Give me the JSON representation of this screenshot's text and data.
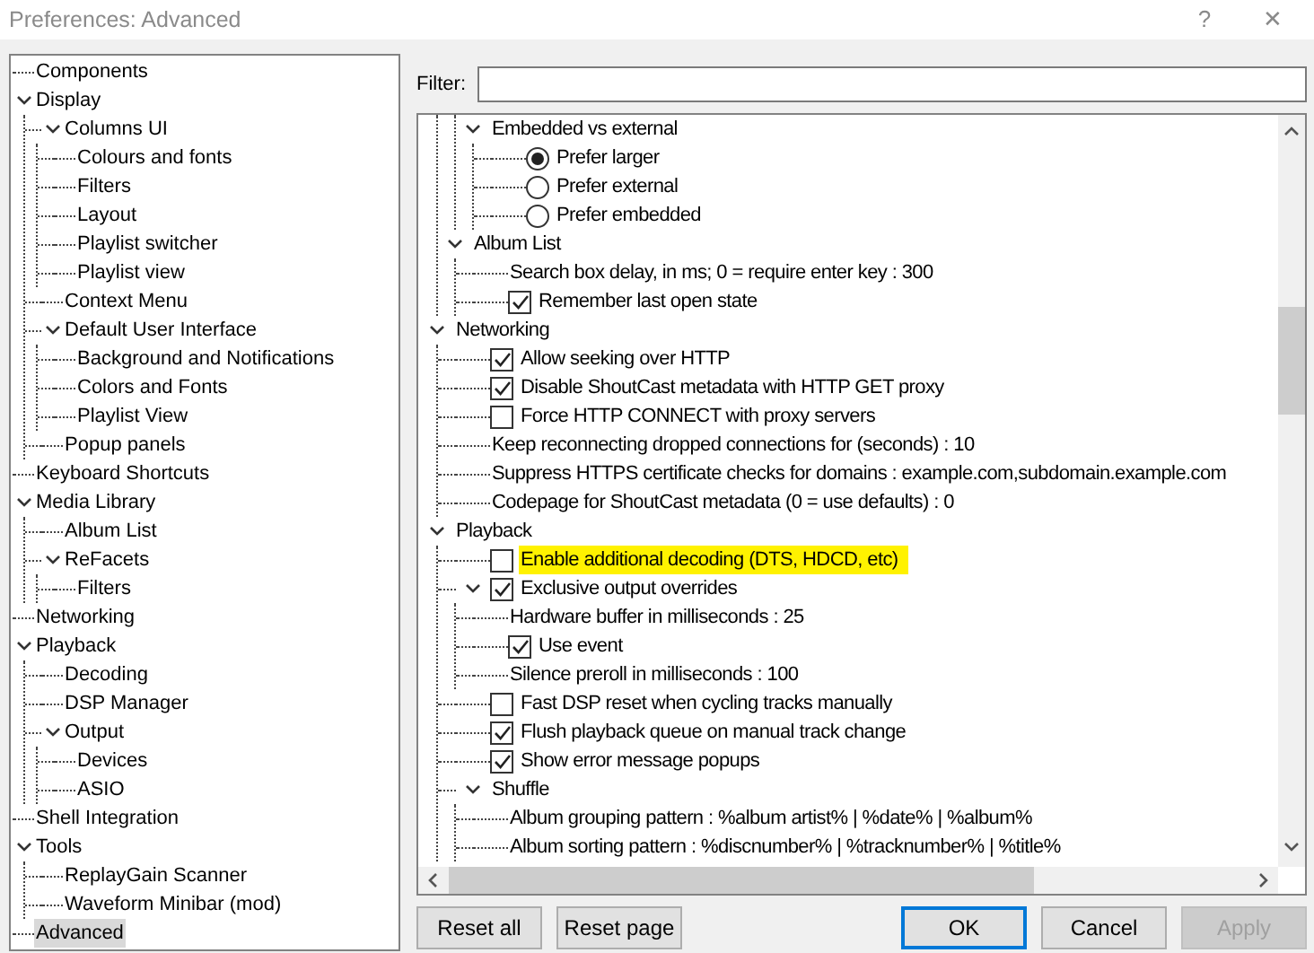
{
  "window": {
    "title": "Preferences: Advanced",
    "buttons": [
      "?",
      "✕"
    ]
  },
  "sidebar": {
    "items": [
      {
        "label": "Components",
        "selected": false
      },
      {
        "label": "Display",
        "selected": false,
        "expanded": true,
        "children": [
          {
            "label": "Columns UI",
            "selected": false,
            "expanded": true,
            "children": [
              {
                "label": "Colours and fonts",
                "selected": false
              },
              {
                "label": "Filters",
                "selected": false
              },
              {
                "label": "Layout",
                "selected": false
              },
              {
                "label": "Playlist switcher",
                "selected": false
              },
              {
                "label": "Playlist view",
                "selected": false
              }
            ]
          },
          {
            "label": "Context Menu",
            "selected": false
          },
          {
            "label": "Default User Interface",
            "selected": false,
            "expanded": true,
            "children": [
              {
                "label": "Background and Notifications",
                "selected": false
              },
              {
                "label": "Colors and Fonts",
                "selected": false
              },
              {
                "label": "Playlist View",
                "selected": false
              }
            ]
          },
          {
            "label": "Popup panels",
            "selected": false
          }
        ]
      },
      {
        "label": "Keyboard Shortcuts",
        "selected": false
      },
      {
        "label": "Media Library",
        "selected": false,
        "expanded": true,
        "children": [
          {
            "label": "Album List",
            "selected": false
          },
          {
            "label": "ReFacets",
            "selected": false,
            "expanded": true,
            "children": [
              {
                "label": "Filters",
                "selected": false
              }
            ]
          }
        ]
      },
      {
        "label": "Networking",
        "selected": false
      },
      {
        "label": "Playback",
        "selected": false,
        "expanded": true,
        "children": [
          {
            "label": "Decoding",
            "selected": false
          },
          {
            "label": "DSP Manager",
            "selected": false
          },
          {
            "label": "Output",
            "selected": false,
            "expanded": true,
            "children": [
              {
                "label": "Devices",
                "selected": false
              },
              {
                "label": "ASIO",
                "selected": false
              }
            ]
          }
        ]
      },
      {
        "label": "Shell Integration",
        "selected": false
      },
      {
        "label": "Tools",
        "selected": false,
        "expanded": true,
        "children": [
          {
            "label": "ReplayGain Scanner",
            "selected": false
          },
          {
            "label": "Waveform Minibar (mod)",
            "selected": false
          }
        ]
      },
      {
        "label": "Advanced",
        "selected": true
      }
    ]
  },
  "filter": {
    "label": "Filter:"
  },
  "settings": [
    {
      "children": [
        {
          "children": [
            {
              "label": "Embedded vs external",
              "expanded": true,
              "children": [
                {
                  "kind": "radio",
                  "label": "Prefer larger",
                  "selected": true
                },
                {
                  "kind": "radio",
                  "label": "Prefer external",
                  "selected": false
                },
                {
                  "kind": "radio",
                  "label": "Prefer embedded",
                  "selected": false
                }
              ]
            }
          ]
        },
        {
          "label": "Album List",
          "expanded": true,
          "children": [
            {
              "kind": "text",
              "label": "Search box delay, in ms; 0 = require enter key : 300"
            },
            {
              "kind": "checkbox",
              "label": "Remember last open state",
              "checked": true
            }
          ]
        }
      ]
    },
    {
      "label": "Networking",
      "expanded": true,
      "children": [
        {
          "kind": "checkbox",
          "label": "Allow seeking over HTTP",
          "checked": true
        },
        {
          "kind": "checkbox",
          "label": "Disable ShoutCast metadata with HTTP GET proxy",
          "checked": true
        },
        {
          "kind": "checkbox",
          "label": "Force HTTP CONNECT with proxy servers",
          "checked": false
        },
        {
          "kind": "text",
          "label": "Keep reconnecting dropped connections for (seconds) : 10"
        },
        {
          "kind": "text",
          "label": "Suppress HTTPS certificate checks for domains : example.com,subdomain.example.com"
        },
        {
          "kind": "text",
          "label": "Codepage for ShoutCast metadata (0 = use defaults) : 0"
        }
      ]
    },
    {
      "label": "Playback",
      "expanded": true,
      "children": [
        {
          "kind": "checkbox",
          "label": "Enable additional decoding (DTS, HDCD, etc)",
          "checked": false,
          "highlighted": true
        },
        {
          "kind": "checkbox",
          "label": "Exclusive output overrides",
          "checked": true,
          "expanded": true,
          "children": [
            {
              "kind": "text",
              "label": "Hardware buffer in milliseconds : 25"
            },
            {
              "kind": "checkbox",
              "label": "Use event",
              "checked": true
            },
            {
              "kind": "text",
              "label": "Silence preroll in milliseconds : 100"
            }
          ]
        },
        {
          "kind": "checkbox",
          "label": "Fast DSP reset when cycling tracks manually",
          "checked": false
        },
        {
          "kind": "checkbox",
          "label": "Flush playback queue on manual track change",
          "checked": true
        },
        {
          "kind": "checkbox",
          "label": "Show error message popups",
          "checked": true
        },
        {
          "label": "Shuffle",
          "expanded": true,
          "children": [
            {
              "kind": "text",
              "label": "Album grouping pattern : %album artist% | %date% | %album%"
            },
            {
              "kind": "text",
              "label": "Album sorting pattern : %discnumber% | %tracknumber% | %title%"
            }
          ]
        }
      ]
    }
  ],
  "buttons": [
    {
      "label": "Reset all",
      "default": false,
      "disabled": false
    },
    {
      "label": "Reset page",
      "default": false,
      "disabled": false
    },
    {
      "label": "OK",
      "default": true,
      "disabled": false
    },
    {
      "label": "Cancel",
      "default": false,
      "disabled": false
    },
    {
      "label": "Apply",
      "default": false,
      "disabled": true
    }
  ]
}
